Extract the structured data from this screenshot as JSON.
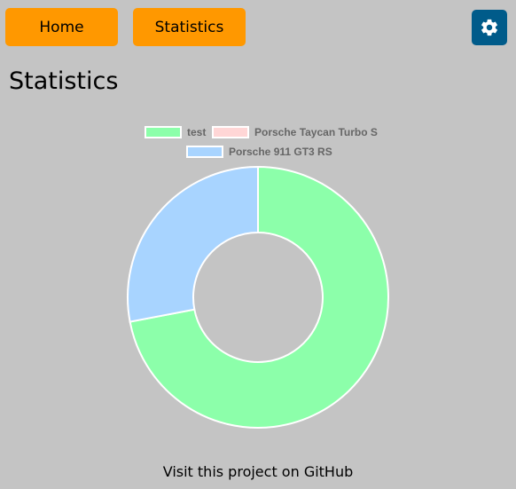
{
  "nav": {
    "home_label": "Home",
    "statistics_label": "Statistics",
    "settings_icon": "gear-icon",
    "button_color": "#ff9800",
    "settings_color": "#005b8a"
  },
  "page": {
    "title": "Statistics",
    "footer_text": "Visit this project on GitHub",
    "background": "#c4c4c4"
  },
  "chart_data": {
    "type": "pie",
    "variant": "doughnut",
    "legend_position": "top",
    "labels": [
      "test",
      "Porsche Taycan Turbo S",
      "Porsche 911 GT3 RS"
    ],
    "values": [
      72,
      0,
      28
    ],
    "colors": [
      "#8cffaa",
      "#ffd6d6",
      "#a8d4ff"
    ]
  }
}
